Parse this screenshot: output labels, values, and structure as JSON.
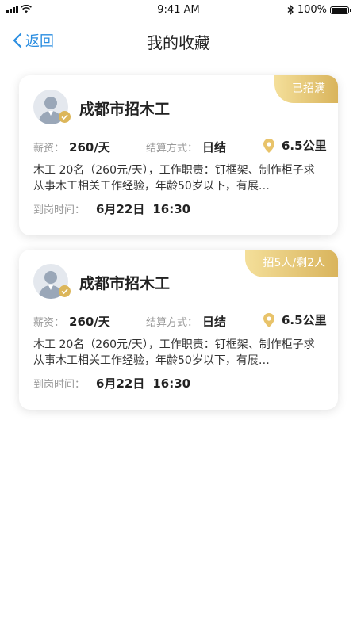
{
  "status_bar": {
    "time": "9:41 AM",
    "battery": "100%"
  },
  "nav": {
    "back_label": "返回",
    "title": "我的收藏"
  },
  "colors": {
    "accent": "#2a8de0",
    "badge_gold": "#d9b45c",
    "pin": "#e8c36a"
  },
  "cards": [
    {
      "badge": "已招满",
      "title": "成都市招木工",
      "pay_label": "薪资：",
      "pay_value": "260/天",
      "settle_label": "结算方式：",
      "settle_value": "日结",
      "distance": "6.5公里",
      "description": "木工 20名（260元/天），工作职责：钉框架、制作柜子求从事木工相关工作经验，年龄50岁以下，有展…",
      "time_label": "到岗时间：",
      "date": "6月22日",
      "clock": "16:30"
    },
    {
      "badge": "招5人/剩2人",
      "title": "成都市招木工",
      "pay_label": "薪资：",
      "pay_value": "260/天",
      "settle_label": "结算方式：",
      "settle_value": "日结",
      "distance": "6.5公里",
      "description": "木工 20名（260元/天），工作职责：钉框架、制作柜子求从事木工相关工作经验，年龄50岁以下，有展…",
      "time_label": "到岗时间：",
      "date": "6月22日",
      "clock": "16:30"
    }
  ]
}
